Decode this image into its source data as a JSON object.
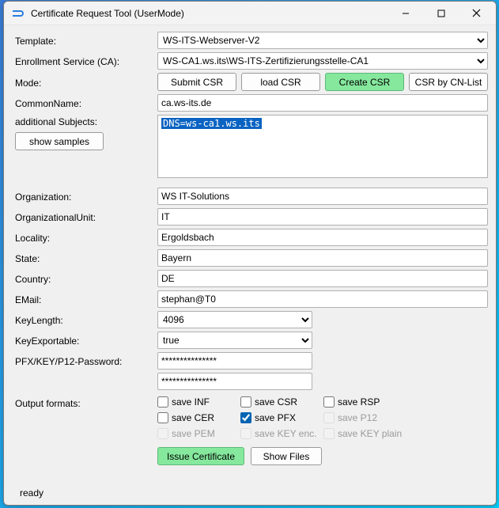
{
  "window": {
    "title": "Certificate Request Tool (UserMode)"
  },
  "labels": {
    "template": "Template:",
    "enrollment": "Enrollment Service (CA):",
    "mode": "Mode:",
    "commonName": "CommonName:",
    "addSubjects": "additional Subjects:",
    "organization": "Organization:",
    "orgUnit": "OrganizationalUnit:",
    "locality": "Locality:",
    "state": "State:",
    "country": "Country:",
    "email": "EMail:",
    "keyLength": "KeyLength:",
    "keyExportable": "KeyExportable:",
    "pfxPassword": "PFX/KEY/P12-Password:",
    "outputFormats": "Output formats:"
  },
  "buttons": {
    "submitCSR": "Submit CSR",
    "loadCSR": "load CSR",
    "createCSR": "Create CSR",
    "csrByCN": "CSR by CN-List",
    "showSamples": "show samples",
    "issueCert": "Issue Certificate",
    "showFiles": "Show Files"
  },
  "values": {
    "template": "WS-ITS-Webserver-V2",
    "enrollment": "WS-CA1.ws.its\\WS-ITS-Zertifizierungsstelle-CA1",
    "commonName": "ca.ws-its.de",
    "addSubjectsSelected": "DNS=ws-ca1.ws.its",
    "organization": "WS IT-Solutions",
    "orgUnit": "IT",
    "locality": "Ergoldsbach",
    "state": "Bayern",
    "country": "DE",
    "email": "stephan@T0",
    "keyLength": "4096",
    "keyExportable": "true",
    "pfxPassword1": "***************",
    "pfxPassword2": "***************"
  },
  "outputs": {
    "saveINF": "save INF",
    "saveCSR": "save CSR",
    "saveRSP": "save RSP",
    "saveCER": "save CER",
    "savePFX": "save PFX",
    "saveP12": "save P12",
    "savePEM": "save PEM",
    "saveKEYenc": "save KEY enc.",
    "saveKEYplain": "save KEY plain"
  },
  "status": "ready"
}
